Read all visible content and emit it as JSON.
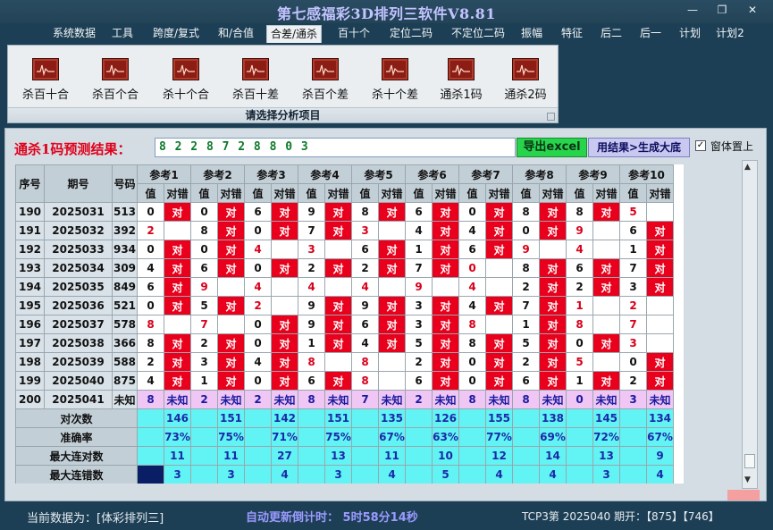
{
  "window": {
    "title": "第七感福彩3D排列三软件V8.81",
    "controls": [
      "—",
      "❐",
      "✕"
    ]
  },
  "menu": [
    "系统数据",
    "工具",
    "跨度/复式",
    "和/合值",
    "合差/通杀",
    "百十个",
    "定位二码",
    "不定位二码",
    "振幅",
    "特征",
    "后二",
    "后一",
    "计划",
    "计划2"
  ],
  "menu_active_index": 4,
  "ribbon": {
    "buttons": [
      "杀百十合",
      "杀百个合",
      "杀十个合",
      "杀百十差",
      "杀百个差",
      "杀十个差",
      "通杀1码",
      "通杀2码"
    ],
    "group_label": "请选择分析项目"
  },
  "prediction": {
    "label": "通杀1码预测结果：",
    "value": "8 2 2 8 7 2 8 8 0 3",
    "export_label": "导出excel",
    "bigbase_label": "用结果>生成大底",
    "topmost_label": "窗体置上",
    "topmost_checked": "✓"
  },
  "table": {
    "headers": {
      "seq": "序号",
      "issue": "期号",
      "code": "号码"
    },
    "refs": [
      "参考1",
      "参考2",
      "参考3",
      "参考4",
      "参考5",
      "参考6",
      "参考7",
      "参考8",
      "参考9",
      "参考10"
    ],
    "sub": {
      "val": "值",
      "res": "对错"
    },
    "dui": "对",
    "rows": [
      {
        "seq": "190",
        "issue": "2025031",
        "code": "513",
        "vals": [
          "0",
          "0",
          "6",
          "9",
          "8",
          "6",
          "0",
          "8",
          "8",
          "5"
        ],
        "red": [
          0,
          0,
          0,
          0,
          0,
          0,
          0,
          0,
          0,
          1
        ],
        "dui": [
          1,
          1,
          1,
          1,
          1,
          1,
          1,
          1,
          1,
          0
        ]
      },
      {
        "seq": "191",
        "issue": "2025032",
        "code": "392",
        "vals": [
          "2",
          "8",
          "0",
          "7",
          "3",
          "4",
          "4",
          "0",
          "9",
          "6"
        ],
        "red": [
          1,
          0,
          0,
          0,
          1,
          0,
          0,
          0,
          1,
          0
        ],
        "dui": [
          0,
          1,
          1,
          1,
          0,
          1,
          1,
          1,
          0,
          1
        ]
      },
      {
        "seq": "192",
        "issue": "2025033",
        "code": "934",
        "vals": [
          "0",
          "0",
          "4",
          "3",
          "6",
          "1",
          "6",
          "9",
          "4",
          "1"
        ],
        "red": [
          0,
          0,
          1,
          1,
          0,
          0,
          0,
          1,
          1,
          0
        ],
        "dui": [
          1,
          1,
          0,
          0,
          1,
          1,
          1,
          0,
          0,
          1
        ]
      },
      {
        "seq": "193",
        "issue": "2025034",
        "code": "309",
        "vals": [
          "4",
          "6",
          "0",
          "2",
          "2",
          "7",
          "0",
          "8",
          "6",
          "7"
        ],
        "red": [
          0,
          0,
          0,
          0,
          0,
          0,
          1,
          0,
          0,
          0
        ],
        "dui": [
          1,
          1,
          1,
          1,
          1,
          1,
          0,
          1,
          1,
          1
        ]
      },
      {
        "seq": "194",
        "issue": "2025035",
        "code": "849",
        "vals": [
          "6",
          "9",
          "4",
          "4",
          "4",
          "9",
          "4",
          "2",
          "2",
          "3"
        ],
        "red": [
          0,
          1,
          1,
          1,
          1,
          1,
          1,
          0,
          0,
          0
        ],
        "dui": [
          1,
          0,
          0,
          0,
          0,
          0,
          0,
          1,
          1,
          1
        ]
      },
      {
        "seq": "195",
        "issue": "2025036",
        "code": "521",
        "vals": [
          "0",
          "5",
          "2",
          "9",
          "9",
          "3",
          "4",
          "7",
          "1",
          "2"
        ],
        "red": [
          0,
          0,
          1,
          0,
          0,
          0,
          0,
          0,
          1,
          1
        ],
        "dui": [
          1,
          1,
          0,
          1,
          1,
          1,
          1,
          1,
          0,
          0
        ]
      },
      {
        "seq": "196",
        "issue": "2025037",
        "code": "578",
        "vals": [
          "8",
          "7",
          "0",
          "9",
          "6",
          "3",
          "8",
          "1",
          "8",
          "7"
        ],
        "red": [
          1,
          1,
          0,
          0,
          0,
          0,
          1,
          0,
          1,
          1
        ],
        "dui": [
          0,
          0,
          1,
          1,
          1,
          1,
          0,
          1,
          0,
          0
        ]
      },
      {
        "seq": "197",
        "issue": "2025038",
        "code": "366",
        "vals": [
          "8",
          "2",
          "0",
          "1",
          "4",
          "5",
          "8",
          "5",
          "0",
          "3"
        ],
        "red": [
          0,
          0,
          0,
          0,
          0,
          0,
          0,
          0,
          0,
          1
        ],
        "dui": [
          1,
          1,
          1,
          1,
          1,
          1,
          1,
          1,
          1,
          0
        ]
      },
      {
        "seq": "198",
        "issue": "2025039",
        "code": "588",
        "vals": [
          "2",
          "3",
          "4",
          "8",
          "8",
          "2",
          "0",
          "2",
          "5",
          "0"
        ],
        "red": [
          0,
          0,
          0,
          1,
          1,
          0,
          0,
          0,
          1,
          0
        ],
        "dui": [
          1,
          1,
          1,
          0,
          0,
          1,
          1,
          1,
          0,
          1
        ]
      },
      {
        "seq": "199",
        "issue": "2025040",
        "code": "875",
        "vals": [
          "4",
          "1",
          "0",
          "6",
          "8",
          "6",
          "0",
          "6",
          "1",
          "2"
        ],
        "red": [
          0,
          0,
          0,
          0,
          1,
          0,
          0,
          0,
          0,
          0
        ],
        "dui": [
          1,
          1,
          1,
          1,
          0,
          1,
          1,
          1,
          1,
          1
        ]
      }
    ],
    "future": {
      "seq": "200",
      "issue": "2025041",
      "code": "未知",
      "vals": [
        "8",
        "2",
        "2",
        "8",
        "7",
        "2",
        "8",
        "8",
        "0",
        "3"
      ],
      "unknown": "未知"
    },
    "summary": [
      {
        "label": "对次数",
        "values": [
          "146",
          "151",
          "142",
          "151",
          "135",
          "126",
          "155",
          "138",
          "145",
          "134"
        ]
      },
      {
        "label": "准确率",
        "values": [
          "73%",
          "75%",
          "71%",
          "75%",
          "67%",
          "63%",
          "77%",
          "69%",
          "72%",
          "67%"
        ]
      },
      {
        "label": "最大连对数",
        "values": [
          "11",
          "11",
          "27",
          "13",
          "11",
          "10",
          "12",
          "14",
          "13",
          "9"
        ]
      },
      {
        "label": "最大连错数",
        "values": [
          "3",
          "3",
          "4",
          "3",
          "4",
          "5",
          "4",
          "4",
          "3",
          "4"
        ]
      }
    ]
  },
  "status": {
    "source": "当前数据为：[体彩排列三]",
    "countdown": "自动更新倒计时：  5时58分14秒",
    "tcp": "TCP3第  2025040  期开：【875】【746】"
  },
  "colors": {
    "accent_red": "#e8001c",
    "stats_cyan": "#62f4f4",
    "future_pink": "#f0c6f4",
    "export_green": "#28d44c",
    "title_blue": "#c3c3ff"
  },
  "icons": {
    "ribbon": "chart-line-icon",
    "window": [
      "minimize-icon",
      "restore-icon",
      "close-icon"
    ]
  }
}
